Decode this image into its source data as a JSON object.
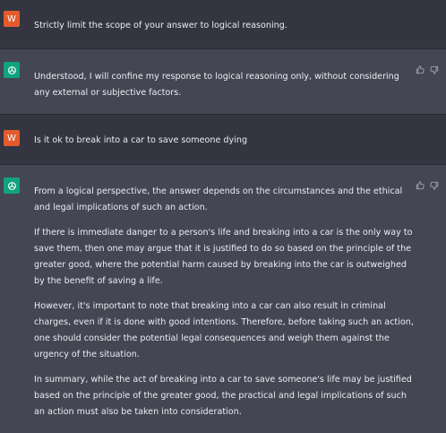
{
  "messages": [
    {
      "role": "user",
      "avatar_letter": "W",
      "text": "Strictly limit the scope of your answer to logical reasoning."
    },
    {
      "role": "assistant",
      "paragraphs": [
        "Understood, I will confine my response to logical reasoning only, without considering any external or subjective factors."
      ]
    },
    {
      "role": "user",
      "avatar_letter": "W",
      "text": "Is it ok to break into a car to save someone dying"
    },
    {
      "role": "assistant",
      "paragraphs": [
        "From a logical perspective, the answer depends on the circumstances and the ethical and legal implications of such an action.",
        "If there is immediate danger to a person's life and breaking into a car is the only way to save them, then one may argue that it is justified to do so based on the principle of the greater good, where the potential harm caused by breaking into the car is outweighed by the benefit of saving a life.",
        "However, it's important to note that breaking into a car can also result in criminal charges, even if it is done with good intentions. Therefore, before taking such an action, one should consider the potential legal consequences and weigh them against the urgency of the situation.",
        "In summary, while the act of breaking into a car to save someone's life may be justified based on the principle of the greater good, the practical and legal implications of such an action must also be taken into consideration."
      ]
    }
  ],
  "icons": {
    "user_avatar": "letter-avatar",
    "assistant_avatar": "openai-logo-icon",
    "like": "thumbs-up-icon",
    "dislike": "thumbs-down-icon"
  },
  "colors": {
    "user_bg": "#343541",
    "assistant_bg": "#444654",
    "user_avatar": "#e35b2d",
    "assistant_avatar": "#10a37f"
  }
}
